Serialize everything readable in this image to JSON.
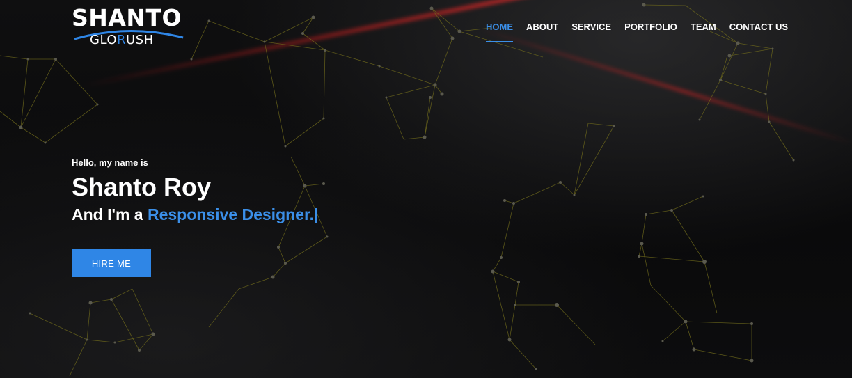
{
  "logo": {
    "top": "SHANTO",
    "bottom_pre": "GLO",
    "bottom_accent": "R",
    "bottom_post": "USH"
  },
  "nav": {
    "items": [
      {
        "label": "HOME",
        "active": true
      },
      {
        "label": "ABOUT",
        "active": false
      },
      {
        "label": "SERVICE",
        "active": false
      },
      {
        "label": "PORTFOLIO",
        "active": false
      },
      {
        "label": "TEAM",
        "active": false
      },
      {
        "label": "CONTACT US",
        "active": false
      }
    ]
  },
  "hero": {
    "greeting": "Hello, my name is",
    "name": "Shanto Roy",
    "tagline_prefix": "And I'm a ",
    "role": "Responsive Designer.|",
    "cta_label": "HIRE ME"
  },
  "colors": {
    "accent": "#2f86e6",
    "background": "#0b0b0c",
    "plexus_line": "#6f6a1c",
    "streak": "#c82020"
  }
}
